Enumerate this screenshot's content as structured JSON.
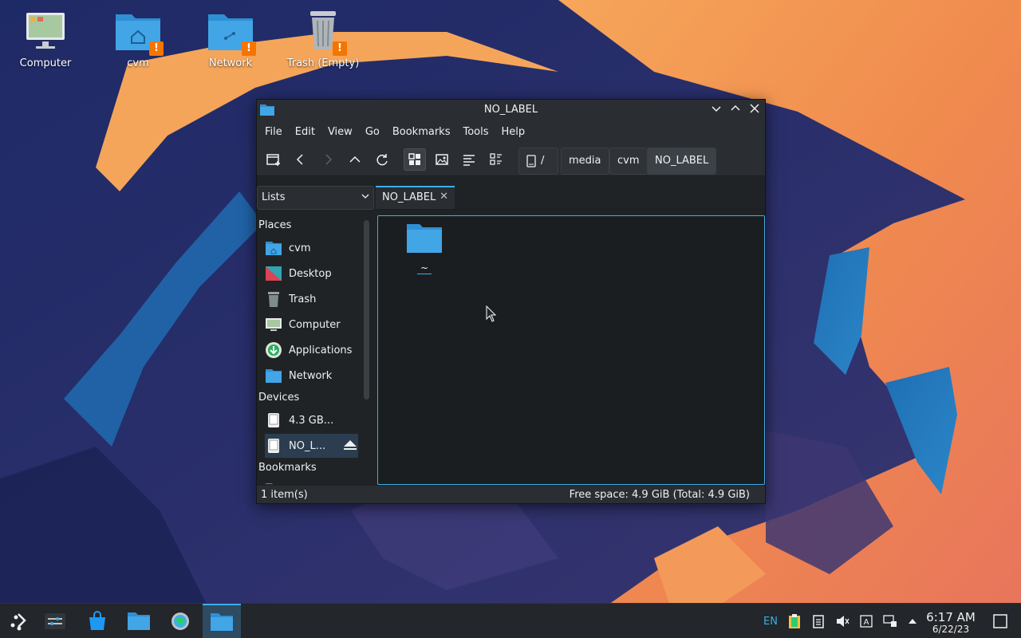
{
  "desktop": {
    "icons": [
      {
        "label": "Computer"
      },
      {
        "label": "cvm"
      },
      {
        "label": "Network"
      },
      {
        "label": "Trash (Empty)"
      }
    ]
  },
  "window": {
    "title": "NO_LABEL",
    "menu": [
      "File",
      "Edit",
      "View",
      "Go",
      "Bookmarks",
      "Tools",
      "Help"
    ],
    "breadcrumb": [
      "/",
      "media",
      "cvm",
      "NO_LABEL"
    ],
    "places_selector": "Lists",
    "tab_label": "NO_LABEL",
    "sidebar": {
      "places_header": "Places",
      "places": [
        "cvm",
        "Desktop",
        "Trash",
        "Computer",
        "Applications",
        "Network"
      ],
      "devices_header": "Devices",
      "devices": [
        "4.3 GB...",
        "NO_L..."
      ],
      "bookmarks_header": "Bookmarks"
    },
    "files": [
      {
        "name": "~"
      }
    ],
    "status_left": "1 item(s)",
    "status_right": "Free space: 4.9 GiB (Total: 4.9 GiB)"
  },
  "taskbar": {
    "keyboard_layout": "EN",
    "time": "6:17 AM",
    "date": "6/22/23"
  },
  "colors": {
    "accent": "#3daee9",
    "warning_badge": "#f67400",
    "window_bg": "#202326",
    "panel_bg": "#23262a"
  }
}
